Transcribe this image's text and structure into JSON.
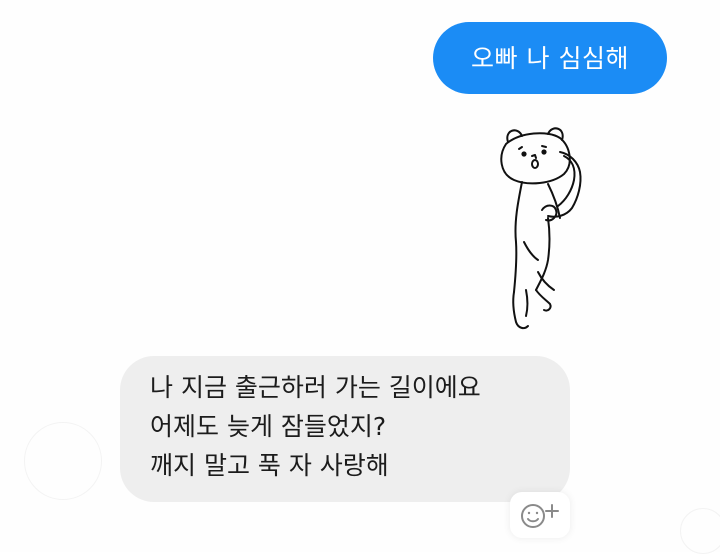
{
  "messages": {
    "sent": {
      "text": "오빠 나 심심해"
    },
    "received": {
      "lines": [
        "나 지금 출근하러 가는 길이에요",
        "어제도 늦게 잠들었지?",
        "깨지 말고 푹 자 사랑해"
      ]
    }
  },
  "sticker": {
    "icon": "bear-sticker-icon"
  },
  "reaction": {
    "icon": "add-reaction-icon"
  },
  "colors": {
    "sent_bubble": "#1b8cf5",
    "received_bubble": "#eeeeee",
    "text_dark": "#1c1c1c",
    "text_light": "#ffffff"
  }
}
